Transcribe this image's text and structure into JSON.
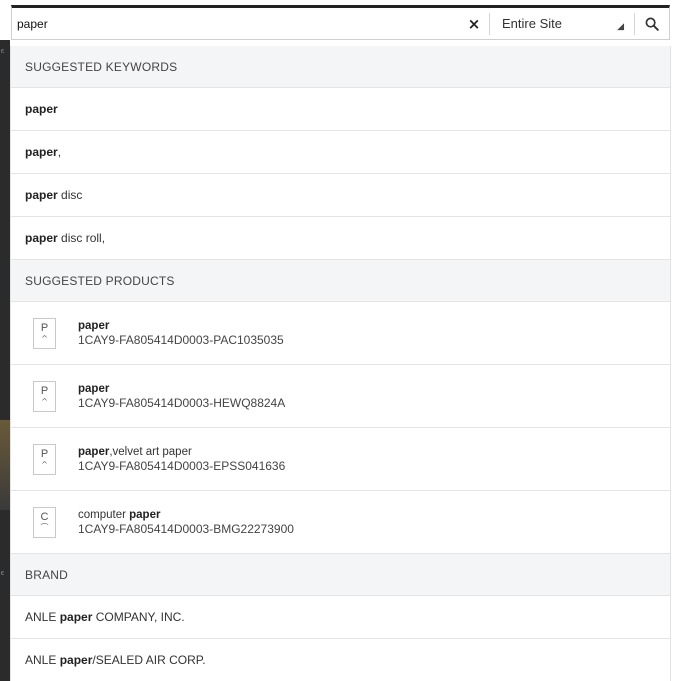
{
  "page": {
    "edge_marks": [
      "ᴱ",
      "ᴱ"
    ]
  },
  "search": {
    "value": "paper",
    "clear_icon": "×",
    "scope_label": "Entire Site",
    "scope_arrow": "◢",
    "search_icon": "magnifier-icon"
  },
  "keywords": {
    "header": "SUGGESTED KEYWORDS",
    "items": [
      {
        "bold": "paper",
        "rest": ""
      },
      {
        "bold": "paper",
        "rest": ","
      },
      {
        "bold": "paper",
        "rest": " disc"
      },
      {
        "bold": "paper",
        "rest": " disc roll,"
      }
    ]
  },
  "products": {
    "header": "SUGGESTED PRODUCTS",
    "items": [
      {
        "thumb": "P",
        "caret": "^",
        "name_pre": "",
        "name_bold": "paper",
        "name_post": "",
        "sku": "1CAY9-FA805414D0003-PAC1035035"
      },
      {
        "thumb": "P",
        "caret": "^",
        "name_pre": "",
        "name_bold": "paper",
        "name_post": "",
        "sku": "1CAY9-FA805414D0003-HEWQ8824A"
      },
      {
        "thumb": "P",
        "caret": "^",
        "name_pre": "",
        "name_bold": "paper",
        "name_post": ",velvet art paper",
        "sku": "1CAY9-FA805414D0003-EPSS041636"
      },
      {
        "thumb": "C",
        "caret": "⌒",
        "name_pre": "computer ",
        "name_bold": "paper",
        "name_post": "",
        "sku": "1CAY9-FA805414D0003-BMG22273900"
      }
    ]
  },
  "brand": {
    "header": "BRAND",
    "items": [
      {
        "pre": "ANLE ",
        "bold": "paper",
        "post": " COMPANY, INC."
      },
      {
        "pre": "ANLE ",
        "bold": "paper",
        "post": "/SEALED AIR CORP."
      }
    ]
  }
}
